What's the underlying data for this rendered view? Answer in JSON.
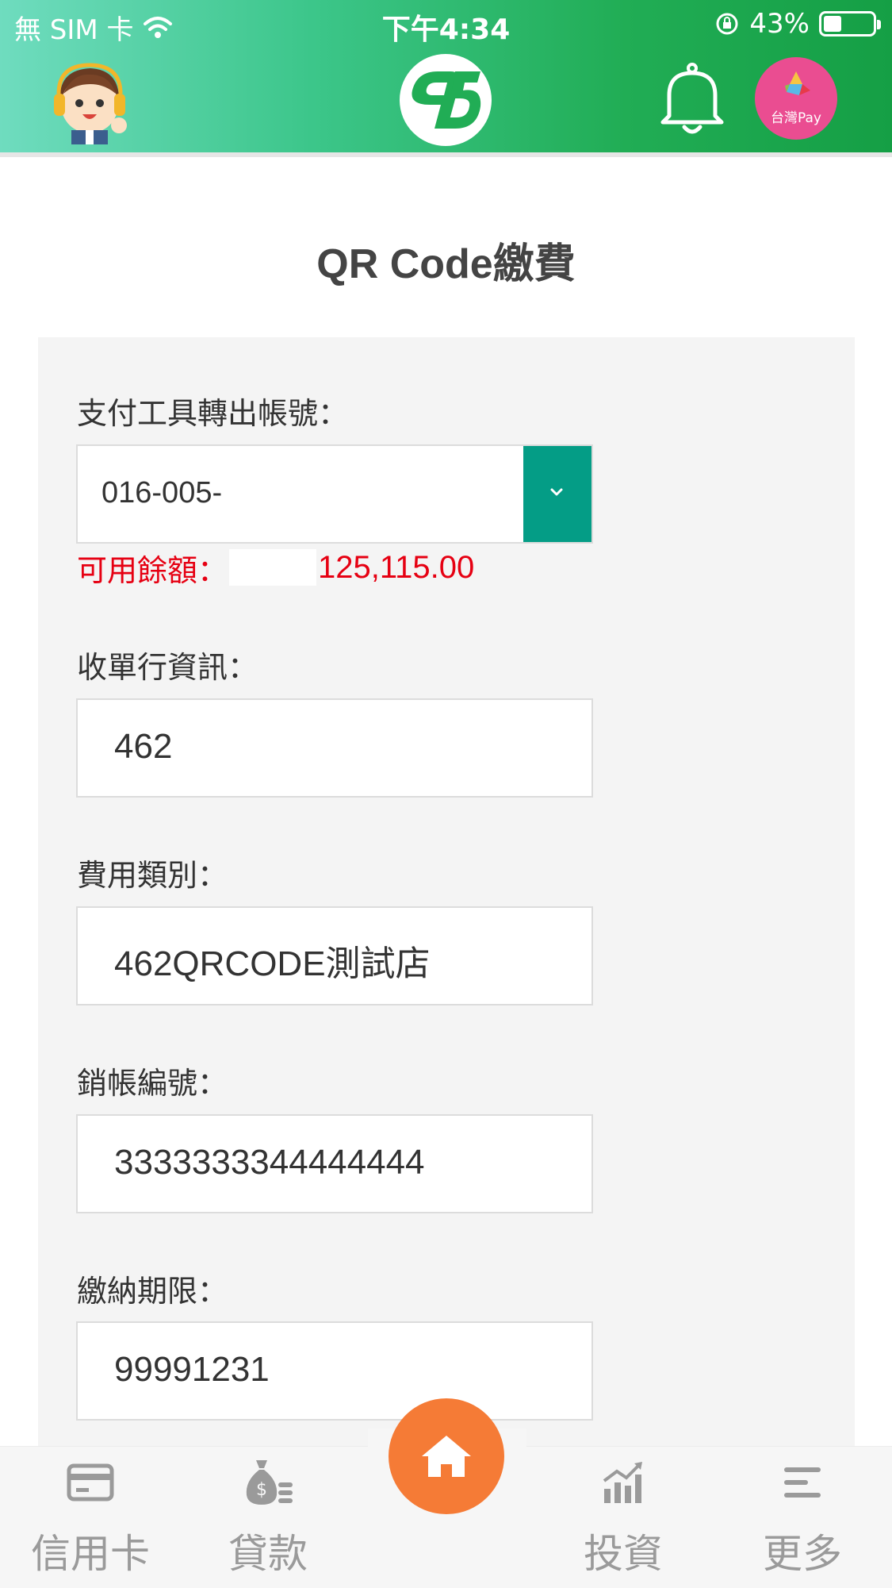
{
  "status_bar": {
    "carrier": "無 SIM 卡",
    "time": "下午4:34",
    "battery_percent": "43%",
    "battery_level": 0.43
  },
  "header": {
    "taiwan_pay_label": "台灣Pay"
  },
  "page": {
    "title": "QR Code繳費"
  },
  "form": {
    "account_label": "支付工具轉出帳號：",
    "account_value": "016-005-",
    "balance_label": "可用餘額：",
    "balance_value": "125,115.00",
    "acquirer_label": "收單行資訊：",
    "acquirer_value": "462",
    "fee_type_label": "費用類別：",
    "fee_type_value": "462QRCODE測試店",
    "writeoff_label": "銷帳編號：",
    "writeoff_value": "3333333344444444",
    "deadline_label": "繳納期限：",
    "deadline_value": "99991231"
  },
  "bottom_nav": {
    "items": [
      {
        "label": "信用卡",
        "icon": "credit-card-icon"
      },
      {
        "label": "貸款",
        "icon": "money-bag-icon"
      },
      {
        "label": "",
        "icon": "home-icon"
      },
      {
        "label": "投資",
        "icon": "bar-chart-icon"
      },
      {
        "label": "更多",
        "icon": "menu-icon"
      }
    ]
  },
  "colors": {
    "header_green": "#21ad55",
    "select_button": "#049d86",
    "balance_red": "#e60012",
    "home_orange": "#f57b36",
    "taiwan_pay_pink": "#ea4d91"
  }
}
